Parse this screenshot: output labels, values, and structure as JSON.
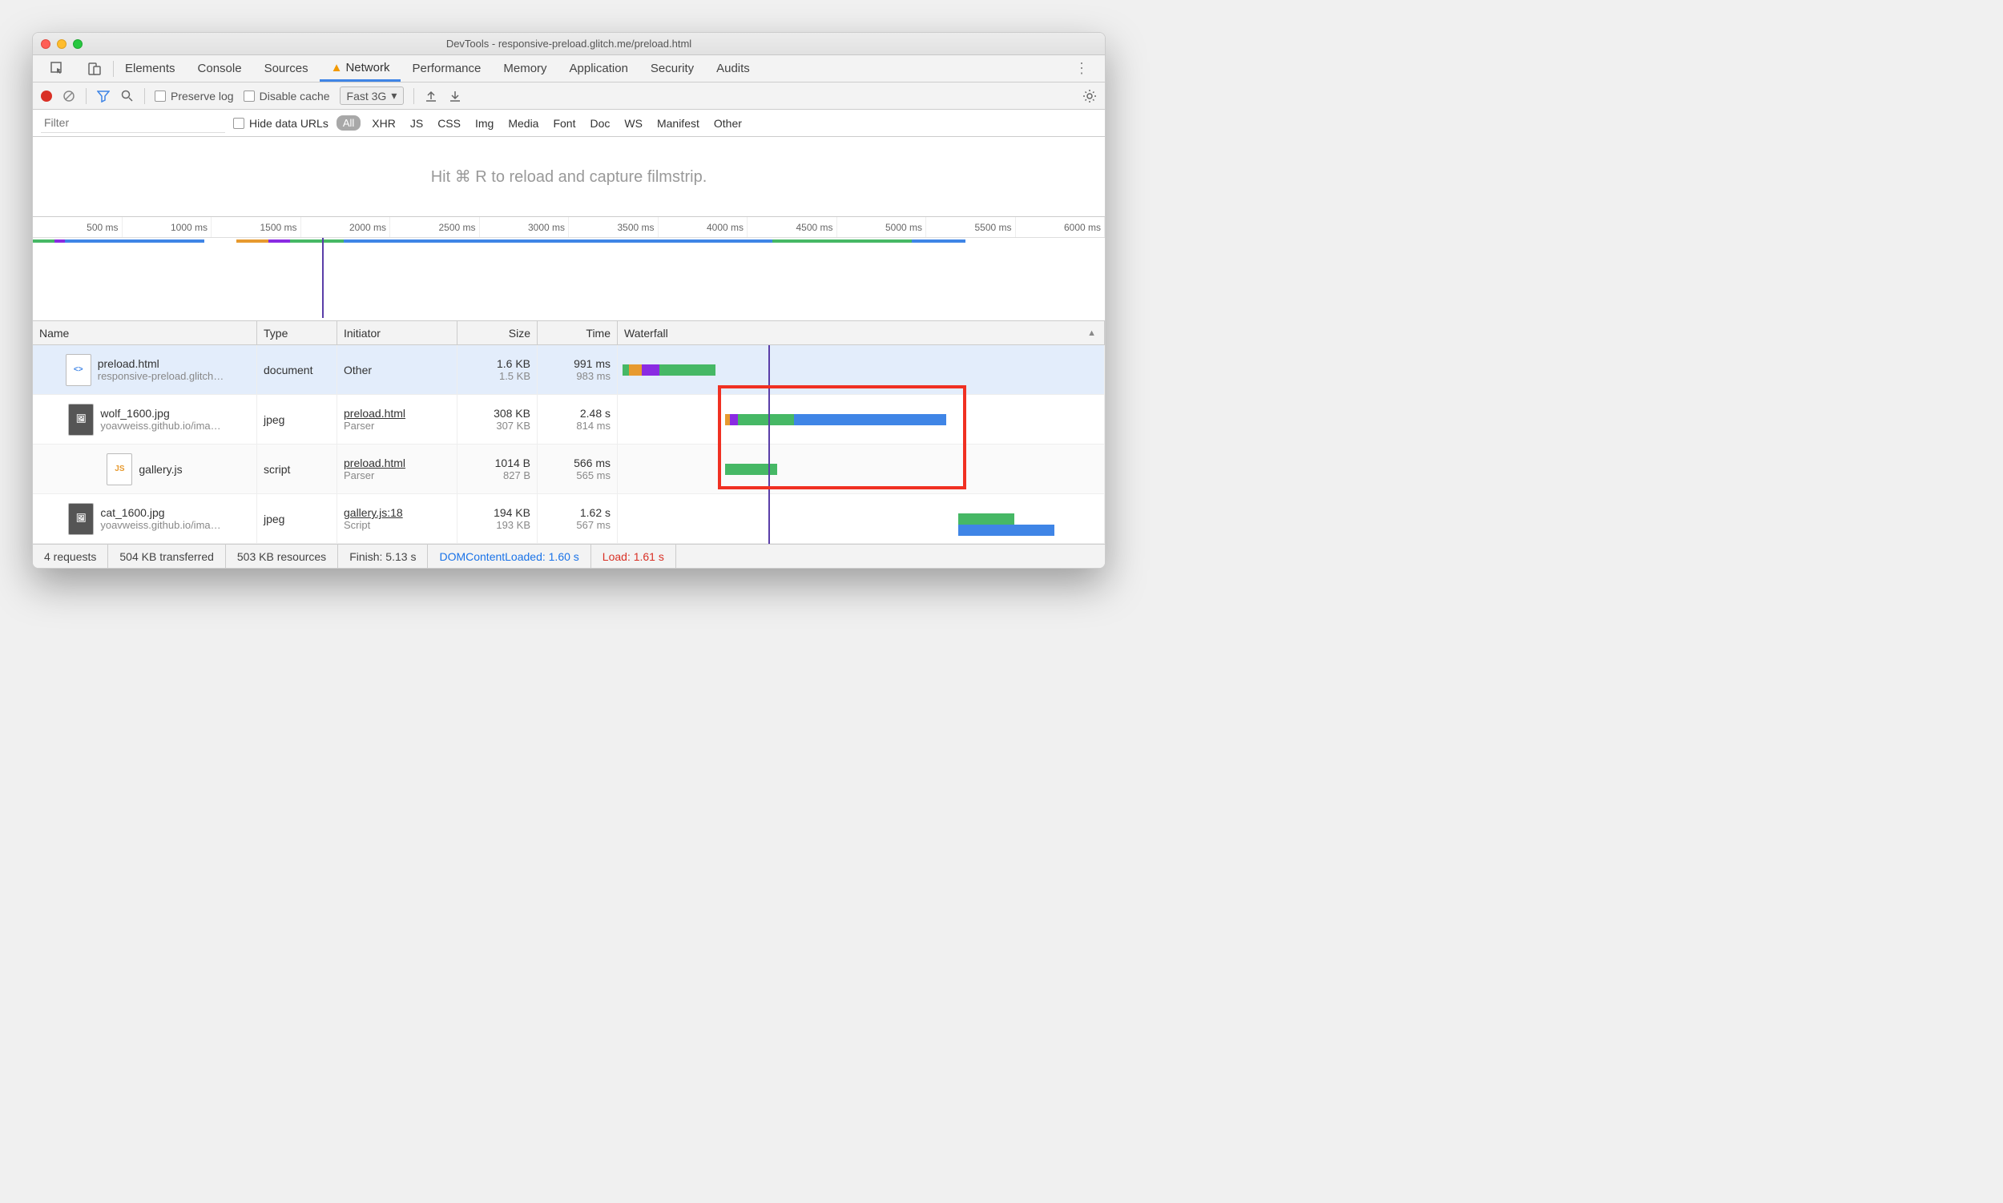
{
  "window": {
    "title": "DevTools - responsive-preload.glitch.me/preload.html"
  },
  "tabs": [
    "Elements",
    "Console",
    "Sources",
    "Network",
    "Performance",
    "Memory",
    "Application",
    "Security",
    "Audits"
  ],
  "active_tab": "Network",
  "toolbar": {
    "preserve_log": "Preserve log",
    "disable_cache": "Disable cache",
    "throttle": "Fast 3G"
  },
  "filterbar": {
    "placeholder": "Filter",
    "hide_data_urls": "Hide data URLs",
    "all": "All",
    "types": [
      "XHR",
      "JS",
      "CSS",
      "Img",
      "Media",
      "Font",
      "Doc",
      "WS",
      "Manifest",
      "Other"
    ]
  },
  "filmstrip_hint": "Hit ⌘ R to reload and capture filmstrip.",
  "timeline_ticks": [
    "500 ms",
    "1000 ms",
    "1500 ms",
    "2000 ms",
    "2500 ms",
    "3000 ms",
    "3500 ms",
    "4000 ms",
    "4500 ms",
    "5000 ms",
    "5500 ms",
    "6000 ms"
  ],
  "columns": {
    "name": "Name",
    "type": "Type",
    "initiator": "Initiator",
    "size": "Size",
    "time": "Time",
    "waterfall": "Waterfall"
  },
  "rows": [
    {
      "name": "preload.html",
      "sub": "responsive-preload.glitch…",
      "type": "document",
      "initiator": "Other",
      "initiator_sub": "",
      "size": "1.6 KB",
      "size_sub": "1.5 KB",
      "time": "991 ms",
      "time_sub": "983 ms",
      "icon": "html"
    },
    {
      "name": "wolf_1600.jpg",
      "sub": "yoavweiss.github.io/ima…",
      "type": "jpeg",
      "initiator": "preload.html",
      "initiator_sub": "Parser",
      "size": "308 KB",
      "size_sub": "307 KB",
      "time": "2.48 s",
      "time_sub": "814 ms",
      "icon": "img"
    },
    {
      "name": "gallery.js",
      "sub": "",
      "type": "script",
      "initiator": "preload.html",
      "initiator_sub": "Parser",
      "size": "1014 B",
      "size_sub": "827 B",
      "time": "566 ms",
      "time_sub": "565 ms",
      "icon": "js"
    },
    {
      "name": "cat_1600.jpg",
      "sub": "yoavweiss.github.io/ima…",
      "type": "jpeg",
      "initiator": "gallery.js:18",
      "initiator_sub": "Script",
      "size": "194 KB",
      "size_sub": "193 KB",
      "time": "1.62 s",
      "time_sub": "567 ms",
      "icon": "img"
    }
  ],
  "summary": {
    "requests": "4 requests",
    "transferred": "504 KB transferred",
    "resources": "503 KB resources",
    "finish": "Finish: 5.13 s",
    "dcl": "DOMContentLoaded: 1.60 s",
    "load": "Load: 1.61 s"
  }
}
